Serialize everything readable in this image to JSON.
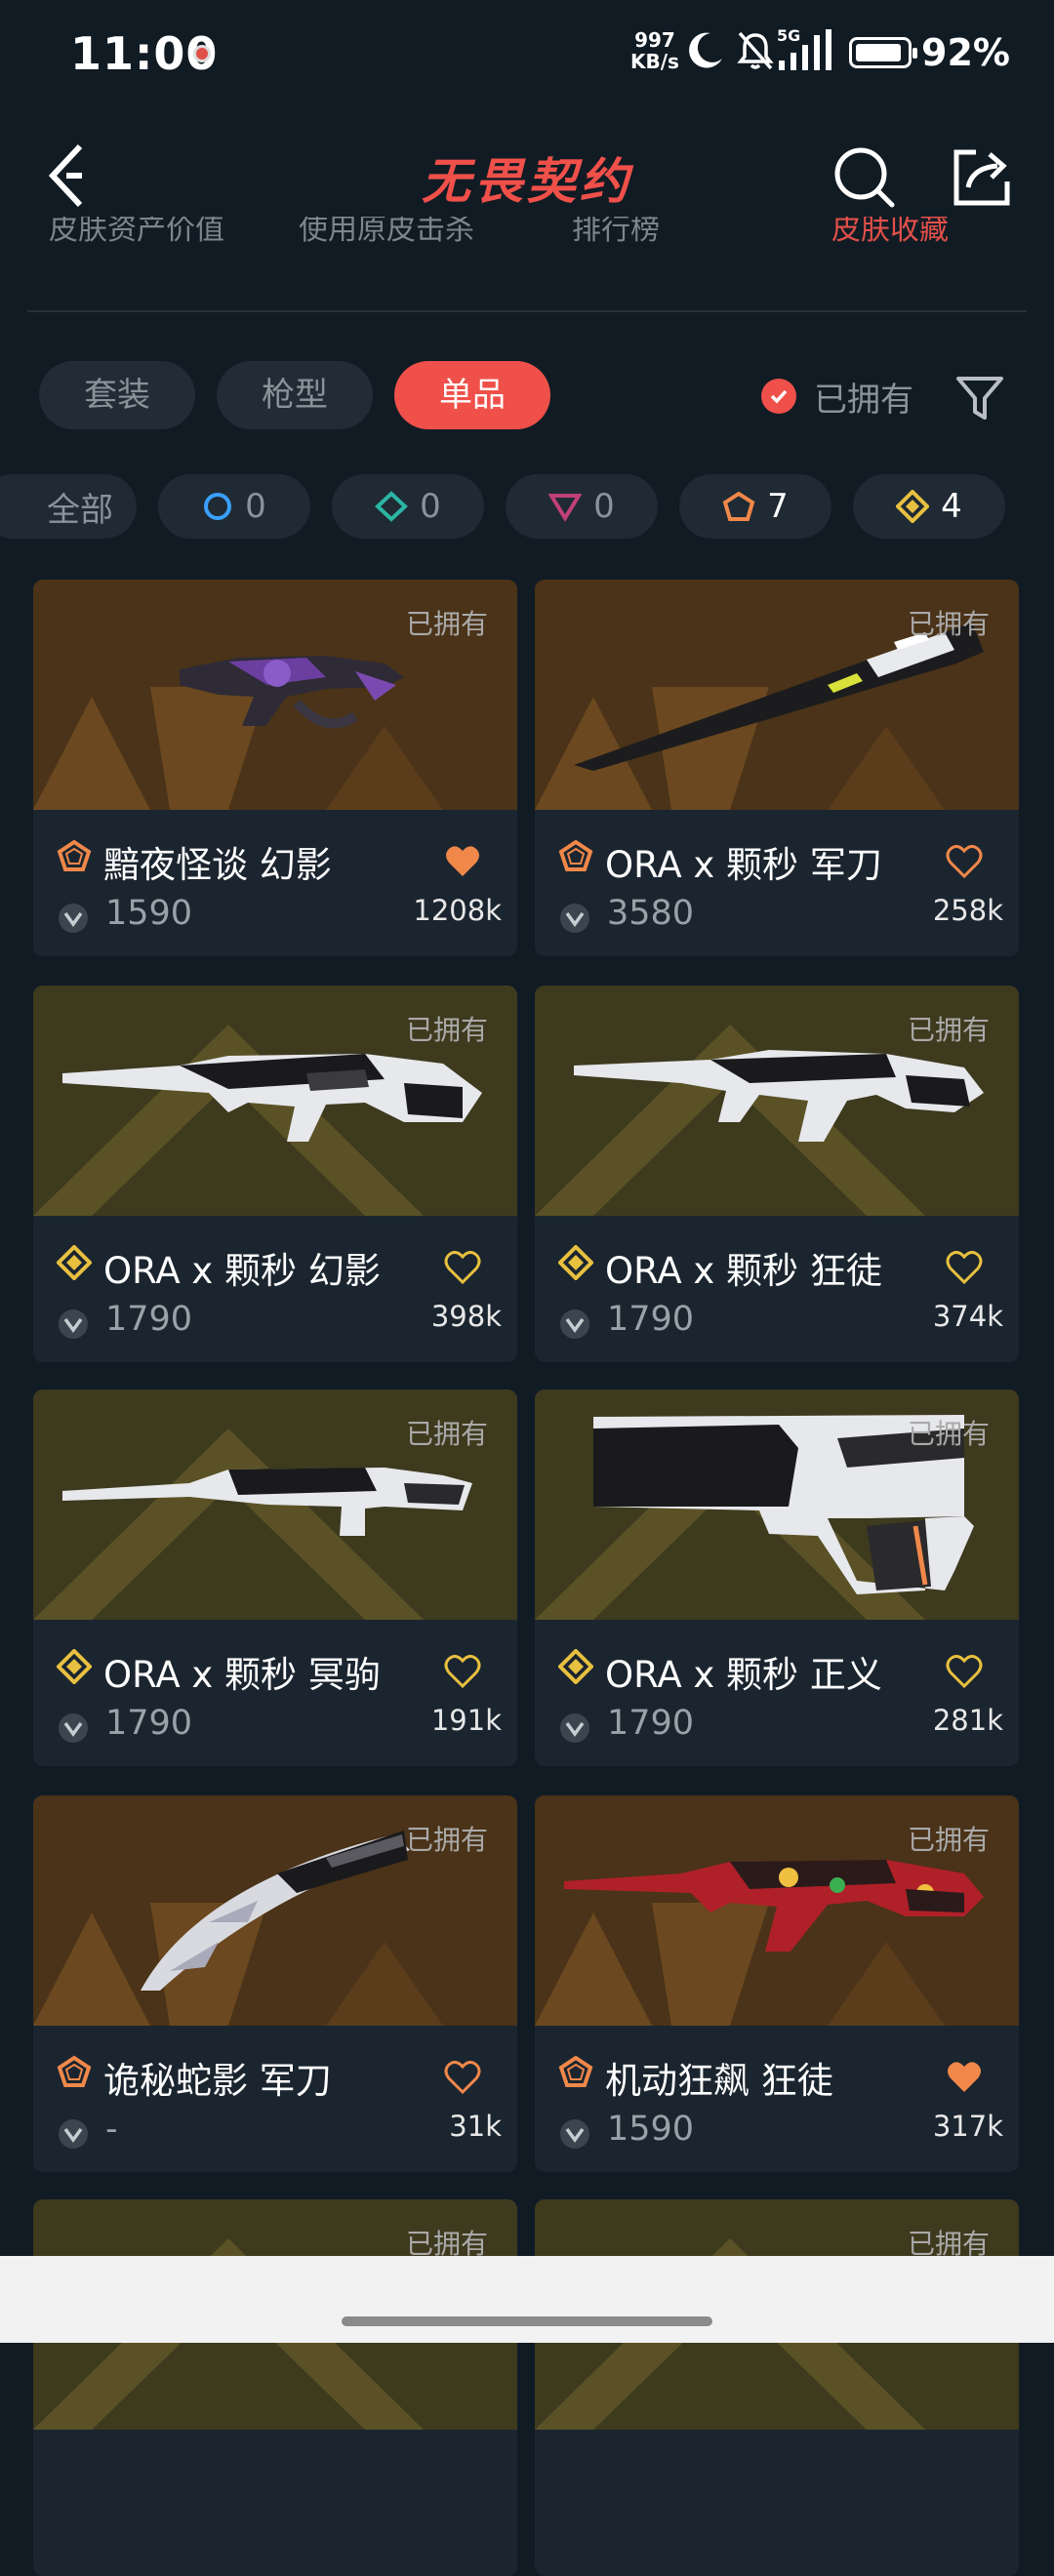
{
  "status_bar": {
    "time": "11:00",
    "speed_value": "997",
    "speed_unit": "KB/s",
    "network": "5G",
    "battery_percent": "92%",
    "battery_level": 0.92,
    "icons": [
      "notification-dot-icon",
      "moon-icon",
      "bell-muted-icon",
      "signal-icon",
      "battery-icon"
    ]
  },
  "header": {
    "title": "无畏契约",
    "icons": [
      "back-arrow-icon",
      "search-icon",
      "share-icon"
    ]
  },
  "sub_tabs": [
    {
      "label": "皮肤资产价值"
    },
    {
      "label": "使用原皮击杀"
    },
    {
      "label": "排行榜"
    },
    {
      "label": "皮肤收藏",
      "active": true
    }
  ],
  "filters": {
    "categories": [
      {
        "label": "套装",
        "active": false
      },
      {
        "label": "枪型",
        "active": false
      },
      {
        "label": "单品",
        "active": true
      }
    ],
    "owned_label": "已拥有",
    "owned_checked": true,
    "filter_icon": "funnel-icon"
  },
  "tiers": [
    {
      "label": "全部",
      "icon": "",
      "count": ""
    },
    {
      "label": "",
      "icon": "select-tier-icon",
      "count": "0",
      "color": "#3aa0ff"
    },
    {
      "label": "",
      "icon": "deluxe-tier-icon",
      "count": "0",
      "color": "#2bb6a4"
    },
    {
      "label": "",
      "icon": "premium-tier-icon",
      "count": "0",
      "color": "#c0407a"
    },
    {
      "label": "",
      "icon": "exclusive-tier-icon",
      "count": "7",
      "color": "#f0884a"
    },
    {
      "label": "",
      "icon": "ultra-tier-icon",
      "count": "4",
      "color": "#e8c040"
    }
  ],
  "cards": [
    {
      "name": "黯夜怪谈 幻影",
      "price": "1590",
      "likes": "1208k",
      "owned_tag": "已拥有",
      "tier": "exclusive",
      "favorited": true
    },
    {
      "name": "ORA x 颗秒 军刀",
      "price": "3580",
      "likes": "258k",
      "owned_tag": "已拥有",
      "tier": "exclusive",
      "favorited": false
    },
    {
      "name": "ORA x 颗秒 幻影",
      "price": "1790",
      "likes": "398k",
      "owned_tag": "已拥有",
      "tier": "ultra",
      "favorited": false
    },
    {
      "name": "ORA x 颗秒 狂徒",
      "price": "1790",
      "likes": "374k",
      "owned_tag": "已拥有",
      "tier": "ultra",
      "favorited": false
    },
    {
      "name": "ORA x 颗秒 冥驹",
      "price": "1790",
      "likes": "191k",
      "owned_tag": "已拥有",
      "tier": "ultra",
      "favorited": false
    },
    {
      "name": "ORA x 颗秒 正义",
      "price": "1790",
      "likes": "281k",
      "owned_tag": "已拥有",
      "tier": "ultra",
      "favorited": false
    },
    {
      "name": "诡秘蛇影 军刀",
      "price": "-",
      "likes": "31k",
      "owned_tag": "已拥有",
      "tier": "exclusive",
      "favorited": false
    },
    {
      "name": "机动狂飙 狂徒",
      "price": "1590",
      "likes": "317k",
      "owned_tag": "已拥有",
      "tier": "exclusive",
      "favorited": true
    },
    {
      "owned_tag": "已拥有"
    },
    {
      "owned_tag": "已拥有"
    }
  ],
  "colors": {
    "accent": "#f0504a",
    "background": "#111b24",
    "card": "#1b252f",
    "exclusive": "#f0884a",
    "ultra": "#e8c040"
  }
}
